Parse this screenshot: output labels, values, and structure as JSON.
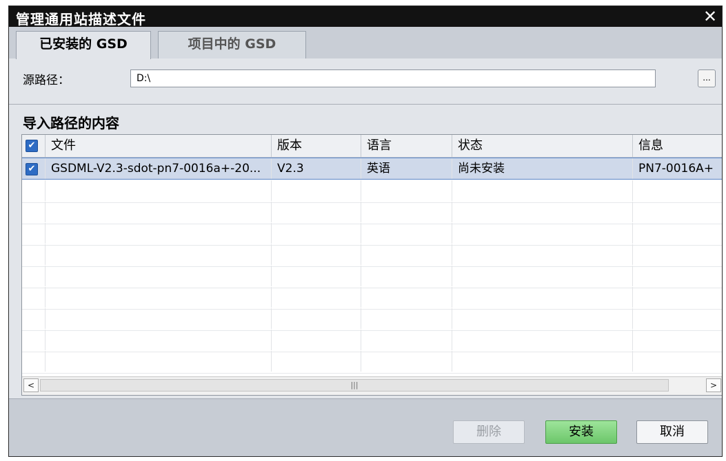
{
  "window": {
    "title": "管理通用站描述文件",
    "close": "✕"
  },
  "tabs": [
    {
      "label": "已安装的 GSD"
    },
    {
      "label": "项目中的 GSD"
    }
  ],
  "source": {
    "label": "源路径：",
    "value": "D:\\",
    "browse": "..."
  },
  "section": {
    "title": "导入路径的内容"
  },
  "table": {
    "columns": [
      "文件",
      "版本",
      "语言",
      "状态",
      "信息"
    ],
    "rows": [
      {
        "checked": true,
        "file": "GSDML-V2.3-sdot-pn7-0016a+-20...",
        "version": "V2.3",
        "language": "英语",
        "status": "尚未安装",
        "info": "PN7-0016A+"
      }
    ]
  },
  "scrollbar": {
    "left": "<",
    "right": ">",
    "thumb": "|||"
  },
  "buttons": {
    "delete": "删除",
    "install": "安装",
    "cancel": "取消"
  }
}
